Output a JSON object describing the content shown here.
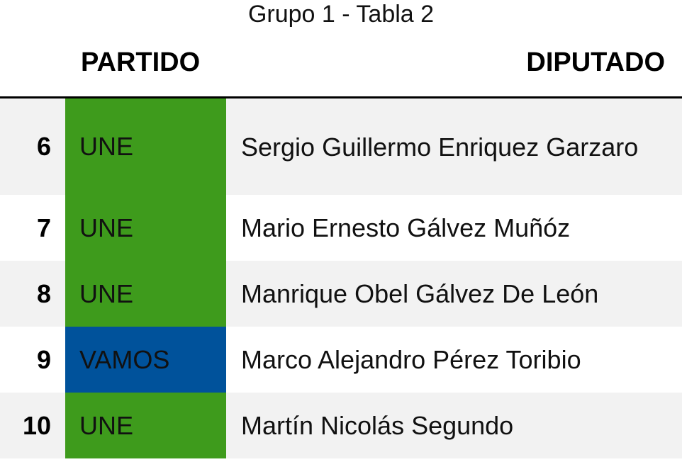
{
  "title": "Grupo 1 - Tabla 2",
  "headers": {
    "number": "",
    "party": "PARTIDO",
    "deputy": "DIPUTADO"
  },
  "party_colors": {
    "UNE": "#3e9b1c",
    "VAMOS": "#00529b"
  },
  "rows": [
    {
      "number": "6",
      "party": "UNE",
      "deputy": "Sergio Guillermo Enriquez Garzaro"
    },
    {
      "number": "7",
      "party": "UNE",
      "deputy": "Mario Ernesto Gálvez Muñóz"
    },
    {
      "number": "8",
      "party": "UNE",
      "deputy": "Manrique Obel Gálvez De León"
    },
    {
      "number": "9",
      "party": "VAMOS",
      "deputy": "Marco Alejandro Pérez Toribio"
    },
    {
      "number": "10",
      "party": "UNE",
      "deputy": "Martín Nicolás Segundo"
    }
  ]
}
